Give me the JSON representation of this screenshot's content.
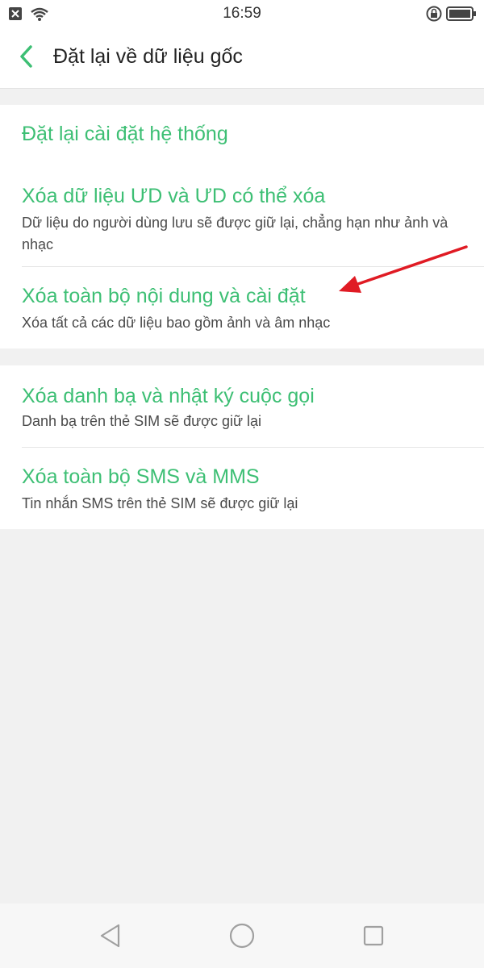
{
  "status_bar": {
    "time": "16:59",
    "left_icons": [
      "sim-blocked-icon",
      "wifi-icon"
    ],
    "right_icons": [
      "rotation-lock-icon",
      "battery-icon"
    ]
  },
  "header": {
    "back_icon": "chevron-left-icon",
    "title": "Đặt lại về dữ liệu gốc"
  },
  "groups": [
    {
      "items": [
        {
          "label": "Đặt lại cài đặt hệ thống"
        },
        {
          "label": "Xóa dữ liệu ƯD và ƯD có thể xóa",
          "description": "Dữ liệu do người dùng lưu sẽ được giữ lại, chẳng hạn như ảnh và nhạc"
        },
        {
          "label": "Xóa toàn bộ nội dung và cài đặt",
          "description": "Xóa tất cả các dữ liệu bao gồm ảnh và âm nhạc"
        }
      ]
    },
    {
      "items": [
        {
          "label": "Xóa danh bạ và nhật ký cuộc gọi",
          "description": "Danh bạ trên thẻ SIM sẽ được giữ lại"
        },
        {
          "label": "Xóa toàn bộ SMS và MMS",
          "description": "Tin nhắn SMS trên thẻ SIM sẽ được giữ lại"
        }
      ]
    }
  ],
  "nav_bar": {
    "icons": [
      "back-triangle-icon",
      "home-circle-icon",
      "recents-square-icon"
    ]
  },
  "colors": {
    "accent": "#3dbf74",
    "annotation_arrow": "#e01b24",
    "background": "#f1f1f1"
  }
}
